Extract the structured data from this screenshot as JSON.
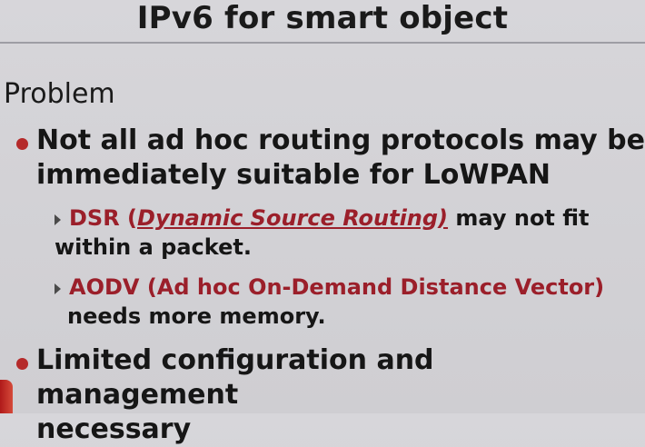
{
  "slide": {
    "title": "IPv6 for smart object",
    "section": "Problem",
    "bullet1": "Not all ad hoc routing protocols may be immediately suitable for LoWPAN",
    "sub1": {
      "term": "DSR",
      "open": "(",
      "expansion": "Dynamic Source Routing)",
      "rest_line1": "may not fit",
      "line2": "within a packet."
    },
    "sub2": {
      "line1": "AODV (Ad hoc On-Demand Distance Vector)",
      "line2": "needs more memory."
    },
    "bullet2_line1": "Limited configuration and management",
    "bullet2_line2": "necessary"
  },
  "colors": {
    "background": "#d5d4d8",
    "accent_red": "#9b1f2a",
    "bullet_red": "#b52a2a",
    "text": "#161616"
  }
}
